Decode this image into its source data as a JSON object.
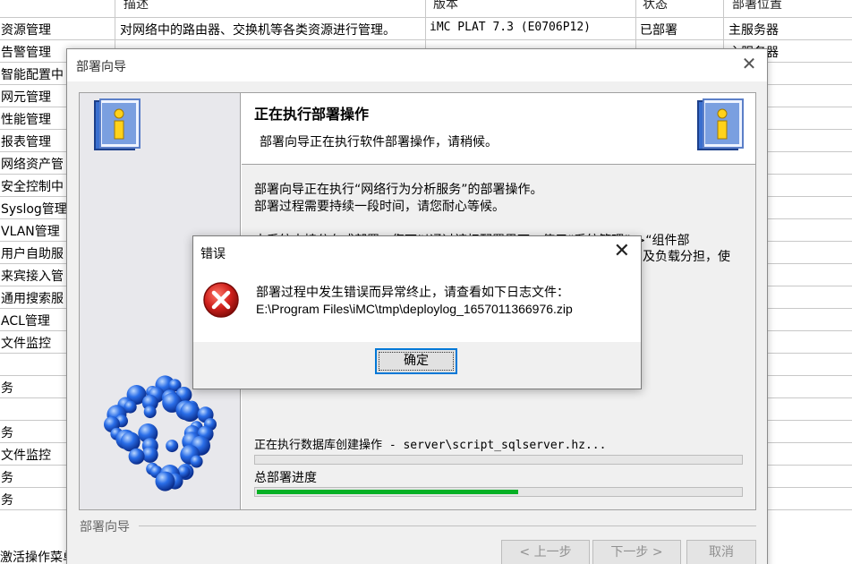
{
  "background_table": {
    "headers": [
      "描述",
      "版本",
      "状态",
      "部署位置"
    ],
    "rows": [
      {
        "name": "资源管理",
        "desc": "对网络中的路由器、交换机等各类资源进行管理。",
        "version": "iMC PLAT 7.3 (E0706P12)",
        "status": "已部署",
        "location": "主服务器"
      },
      {
        "name": "告警管理",
        "desc": "",
        "version": "",
        "status": "",
        "location": "主服务器"
      },
      {
        "name": "智能配置中",
        "desc": "",
        "version": "",
        "status": "",
        "location": "器"
      },
      {
        "name": "网元管理",
        "desc": "",
        "version": "",
        "status": "",
        "location": "器"
      },
      {
        "name": "性能管理",
        "desc": "",
        "version": "",
        "status": "",
        "location": "器"
      },
      {
        "name": "报表管理",
        "desc": "",
        "version": "",
        "status": "",
        "location": "器"
      },
      {
        "name": "网络资产管",
        "desc": "",
        "version": "",
        "status": "",
        "location": "器"
      },
      {
        "name": "安全控制中",
        "desc": "",
        "version": "",
        "status": "",
        "location": "器"
      },
      {
        "name": "Syslog管理",
        "desc": "",
        "version": "",
        "status": "",
        "location": "器"
      },
      {
        "name": "VLAN管理",
        "desc": "",
        "version": "",
        "status": "",
        "location": "器"
      },
      {
        "name": "用户自助服",
        "desc": "",
        "version": "",
        "status": "",
        "location": "器"
      },
      {
        "name": "来宾接入管",
        "desc": "",
        "version": "",
        "status": "",
        "location": "器"
      },
      {
        "name": "通用搜索服",
        "desc": "",
        "version": "",
        "status": "",
        "location": "器"
      },
      {
        "name": "ACL管理",
        "desc": "",
        "version": "",
        "status": "",
        "location": "器"
      },
      {
        "name": "文件监控",
        "desc": "",
        "version": "",
        "status": "",
        "location": "器"
      },
      {
        "name": "",
        "desc": "",
        "version": "",
        "status": "",
        "location": "器"
      },
      {
        "name": "务",
        "desc": "",
        "version": "",
        "status": "",
        "location": "器"
      },
      {
        "name": "",
        "desc": "",
        "version": "",
        "status": "",
        "location": "器"
      },
      {
        "name": "务",
        "desc": "",
        "version": "",
        "status": "",
        "location": ""
      },
      {
        "name": "文件监控",
        "desc": "",
        "version": "",
        "status": "",
        "location": ""
      },
      {
        "name": "务",
        "desc": "",
        "version": "",
        "status": "",
        "location": "器"
      },
      {
        "name": "务",
        "desc": "",
        "version": "",
        "status": "",
        "location": ""
      }
    ],
    "bottom_text": "激活操作菜单"
  },
  "wizard": {
    "title": "部署向导",
    "close_glyph": "✕",
    "header_title": "正在执行部署操作",
    "header_subtitle": "部署向导正在执行软件部署操作，请稍候。",
    "line1": "部署向导正在执行“网络行为分析服务”的部署操作。",
    "line2": "部署过程需要持续一段时间，请您耐心等候。",
    "line3_fragment": "本系统支持分布式部署，您可以通过该扫配置界面，使用“系统管理”->“组件部",
    "line3_tail": "及负载分担，使",
    "current_operation": "正在执行数据库创建操作 - server\\script_sqlserver.hz...",
    "current_progress": 0,
    "overall_label": "总部署进度",
    "overall_progress": 0.54,
    "footer_label": "部署向导",
    "prev_button": "< 上一步",
    "next_button": "下一步 >",
    "cancel_button": "取消"
  },
  "error_dialog": {
    "title": "错误",
    "close_glyph": "✕",
    "message_line1": "部署过程中发生错误而异常终止，请查看如下日志文件：",
    "message_line2": "E:\\Program Files\\iMC\\tmp\\deploylog_1657011366976.zip",
    "ok_button": "确定"
  },
  "colors": {
    "progress_fill": "#06b025",
    "error_icon": "#d0201c",
    "dialog_focus": "#0078d7"
  }
}
